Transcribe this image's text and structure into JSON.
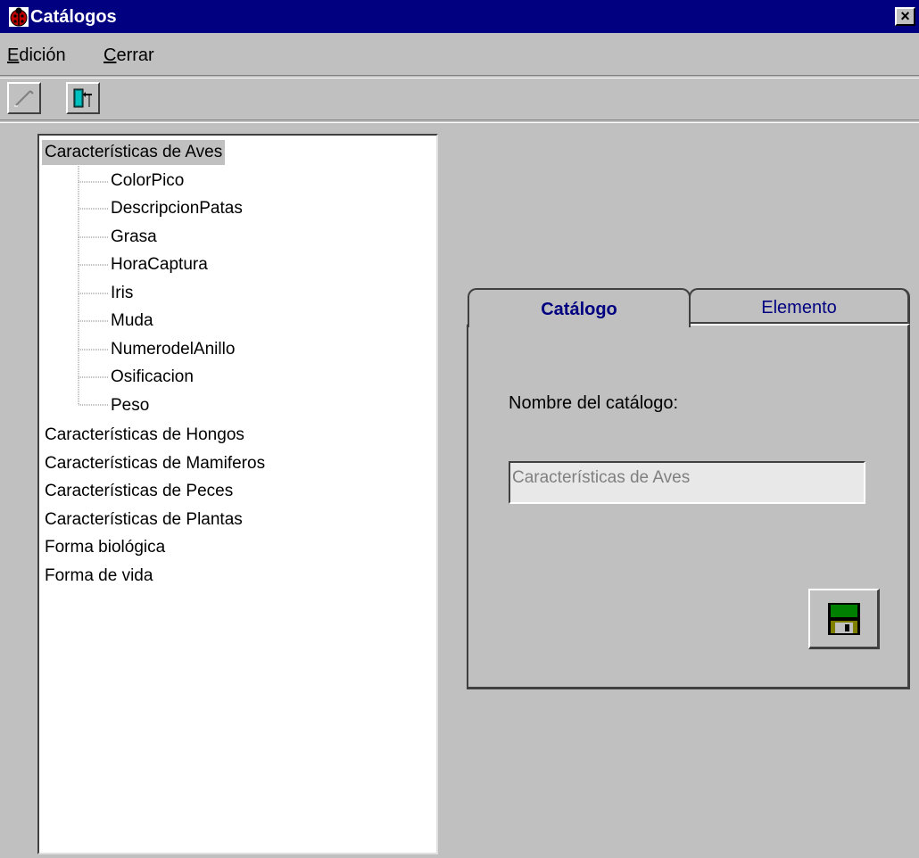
{
  "window": {
    "title": "Catálogos",
    "close_glyph": "×"
  },
  "menu": {
    "items": [
      {
        "accel": "E",
        "rest": "dición"
      },
      {
        "accel": "C",
        "rest": "errar"
      }
    ]
  },
  "toolbar": {
    "buttons": [
      {
        "icon": "edit-pencil-icon"
      },
      {
        "icon": "exit-door-icon"
      }
    ]
  },
  "tree": {
    "nodes": [
      {
        "label": "Características de Aves",
        "selected": true
      },
      {
        "label": "ColorPico"
      },
      {
        "label": "DescripcionPatas"
      },
      {
        "label": "Grasa"
      },
      {
        "label": "HoraCaptura"
      },
      {
        "label": "Iris"
      },
      {
        "label": "Muda"
      },
      {
        "label": "NumerodelAnillo"
      },
      {
        "label": "Osificacion"
      },
      {
        "label": "Peso"
      },
      {
        "label": "Características de Hongos"
      },
      {
        "label": "Características de Mamiferos"
      },
      {
        "label": "Características de Peces"
      },
      {
        "label": "Características de Plantas"
      },
      {
        "label": "Forma biológica"
      },
      {
        "label": "Forma de vida"
      }
    ]
  },
  "tabs": {
    "active": "Catálogo",
    "inactive": "Elemento"
  },
  "form": {
    "catalog_label": "Nombre del catálogo:",
    "catalog_value": "Características de Aves"
  },
  "colors": {
    "titlebar": "#000080",
    "face": "#c0c0c0",
    "tab_text": "#000080"
  }
}
